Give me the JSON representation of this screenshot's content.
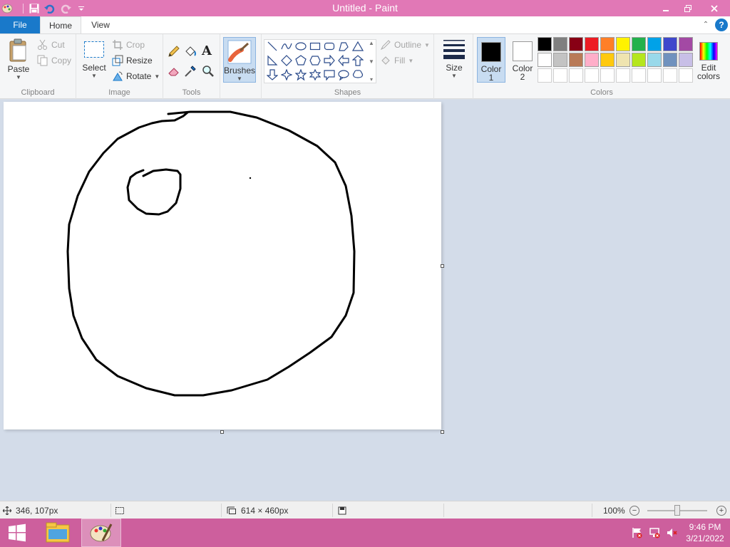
{
  "window": {
    "title": "Untitled - Paint"
  },
  "tabs": {
    "file": "File",
    "home": "Home",
    "view": "View"
  },
  "clipboard": {
    "paste": "Paste",
    "cut": "Cut",
    "copy": "Copy",
    "label": "Clipboard"
  },
  "image": {
    "select": "Select",
    "crop": "Crop",
    "resize": "Resize",
    "rotate": "Rotate",
    "label": "Image"
  },
  "tools": {
    "label": "Tools"
  },
  "brushes": {
    "label": "Brushes"
  },
  "shapes": {
    "outline": "Outline",
    "fill": "Fill",
    "label": "Shapes"
  },
  "size": {
    "label": "Size"
  },
  "colors": {
    "color1": "Color",
    "color1_num": "1",
    "color2": "Color",
    "color2_num": "2",
    "edit": "Edit",
    "edit2": "colors",
    "label": "Colors",
    "color1_value": "#000000",
    "color2_value": "#ffffff",
    "palette_row1": [
      "#000000",
      "#7f7f7f",
      "#880015",
      "#ed1c24",
      "#ff7f27",
      "#fff200",
      "#22b14c",
      "#00a2e8",
      "#3f48cc",
      "#a349a4"
    ],
    "palette_row2": [
      "#ffffff",
      "#c3c3c3",
      "#b97a57",
      "#ffaec9",
      "#ffc90e",
      "#efe4b0",
      "#b5e61d",
      "#99d9ea",
      "#7092be",
      "#c8bfe7"
    ]
  },
  "status": {
    "cursor_pos": "346, 107px",
    "canvas_size": "614 × 460px",
    "zoom": "100%"
  },
  "taskbar": {
    "time": "9:46 PM",
    "date": "3/21/2022"
  }
}
